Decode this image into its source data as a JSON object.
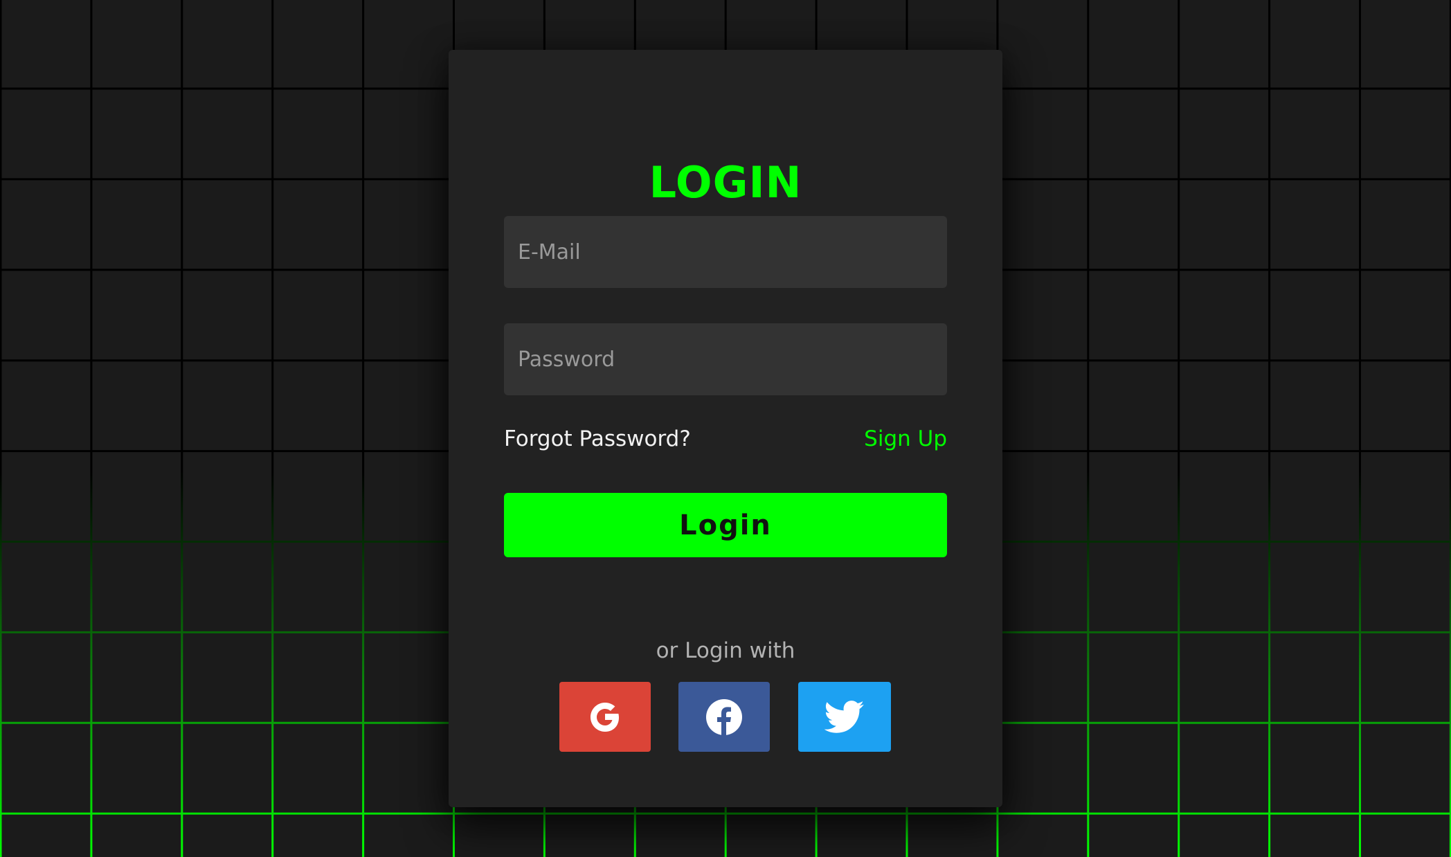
{
  "login": {
    "title": "LOGIN",
    "email_placeholder": "E-Mail",
    "password_placeholder": "Password",
    "forgot_label": "Forgot Password?",
    "signup_label": "Sign Up",
    "login_button_label": "Login",
    "or_text": "or Login with",
    "social": [
      {
        "name": "google",
        "icon": "google-icon",
        "color": "#db4437"
      },
      {
        "name": "facebook",
        "icon": "facebook-icon",
        "color": "#3b5998"
      },
      {
        "name": "twitter",
        "icon": "twitter-icon",
        "color": "#1da1f2"
      }
    ]
  },
  "colors": {
    "accent": "#00ff00",
    "card_bg": "#222222",
    "field_bg": "#333333",
    "page_bg": "#1b1b1b",
    "grid_line": "#000000"
  }
}
